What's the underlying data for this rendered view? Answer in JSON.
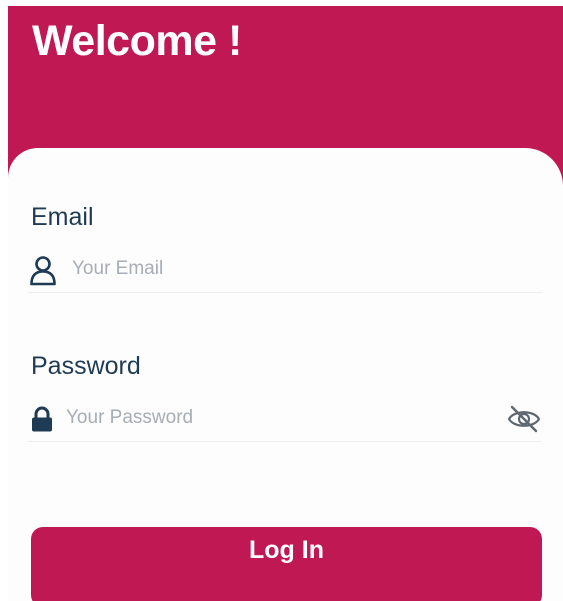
{
  "header": {
    "title": "Welcome !"
  },
  "form": {
    "email": {
      "label": "Email",
      "placeholder": "Your Email",
      "icon": "user-icon"
    },
    "password": {
      "label": "Password",
      "placeholder": "Your Password",
      "icon": "lock-icon",
      "toggle_icon": "eye-off-icon"
    },
    "submit_label": "Log In"
  },
  "colors": {
    "brand": "#c01853",
    "label_text": "#1f3a55",
    "placeholder_text": "#a6adb5",
    "background": "#ffffff"
  }
}
